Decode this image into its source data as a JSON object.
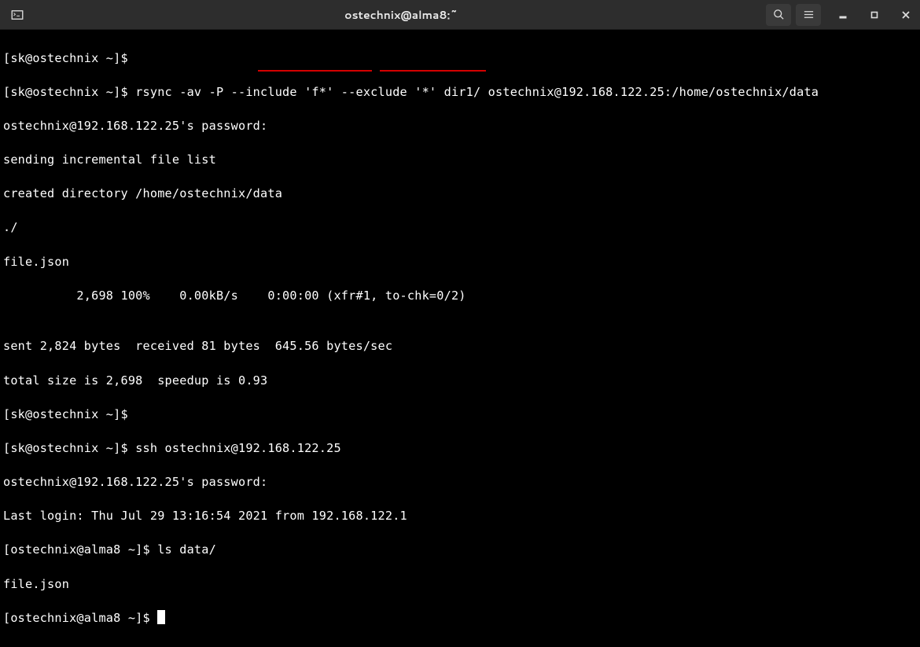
{
  "window": {
    "title": "ostechnix@alma8:~"
  },
  "lines": {
    "l0": "[sk@ostechnix ~]$ ",
    "l1_prompt": "[sk@ostechnix ~]$ ",
    "l1_cmd": "rsync -av -P --include 'f*' --exclude '*' dir1/ ostechnix@192.168.122.25:/home/ostechnix/data",
    "l2": "ostechnix@192.168.122.25's password:",
    "l3": "sending incremental file list",
    "l4": "created directory /home/ostechnix/data",
    "l5": "./",
    "l6": "file.json",
    "l7": "          2,698 100%    0.00kB/s    0:00:00 (xfr#1, to-chk=0/2)",
    "l8": "",
    "l9": "sent 2,824 bytes  received 81 bytes  645.56 bytes/sec",
    "l10": "total size is 2,698  speedup is 0.93",
    "l11": "[sk@ostechnix ~]$ ",
    "l12_prompt": "[sk@ostechnix ~]$ ",
    "l12_cmd": "ssh ostechnix@192.168.122.25",
    "l13": "ostechnix@192.168.122.25's password:",
    "l14": "Last login: Thu Jul 29 13:16:54 2021 from 192.168.122.1",
    "l15_prompt": "[ostechnix@alma8 ~]$ ",
    "l15_cmd": "ls data/",
    "l16": "file.json",
    "l17": "[ostechnix@alma8 ~]$ "
  }
}
